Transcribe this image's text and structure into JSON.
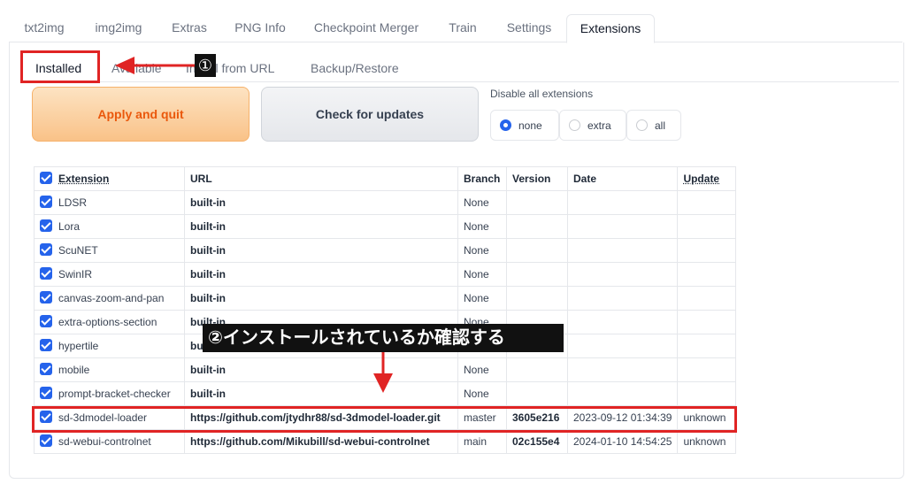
{
  "top_tabs": [
    "txt2img",
    "img2img",
    "Extras",
    "PNG Info",
    "Checkpoint Merger",
    "Train",
    "Settings",
    "Extensions"
  ],
  "sub_tabs": [
    "Installed",
    "Available",
    "Install from URL",
    "Backup/Restore"
  ],
  "buttons": {
    "apply": "Apply and quit",
    "check": "Check for updates"
  },
  "disable": {
    "label": "Disable all extensions",
    "options": [
      "none",
      "extra",
      "all"
    ],
    "selected": "none"
  },
  "table": {
    "headers": [
      "Extension",
      "URL",
      "Branch",
      "Version",
      "Date",
      "Update"
    ],
    "rows": [
      {
        "name": "LDSR",
        "url": "built-in",
        "branch": "None",
        "version": "",
        "date": "",
        "update": ""
      },
      {
        "name": "Lora",
        "url": "built-in",
        "branch": "None",
        "version": "",
        "date": "",
        "update": ""
      },
      {
        "name": "ScuNET",
        "url": "built-in",
        "branch": "None",
        "version": "",
        "date": "",
        "update": ""
      },
      {
        "name": "SwinIR",
        "url": "built-in",
        "branch": "None",
        "version": "",
        "date": "",
        "update": ""
      },
      {
        "name": "canvas-zoom-and-pan",
        "url": "built-in",
        "branch": "None",
        "version": "",
        "date": "",
        "update": ""
      },
      {
        "name": "extra-options-section",
        "url": "built-in",
        "branch": "None",
        "version": "",
        "date": "",
        "update": ""
      },
      {
        "name": "hypertile",
        "url": "built-in",
        "branch": "None",
        "version": "",
        "date": "",
        "update": ""
      },
      {
        "name": "mobile",
        "url": "built-in",
        "branch": "None",
        "version": "",
        "date": "",
        "update": ""
      },
      {
        "name": "prompt-bracket-checker",
        "url": "built-in",
        "branch": "None",
        "version": "",
        "date": "",
        "update": ""
      },
      {
        "name": "sd-3dmodel-loader",
        "url": "https://github.com/jtydhr88/sd-3dmodel-loader.git",
        "branch": "master",
        "version": "3605e216",
        "date": "2023-09-12 01:34:39",
        "update": "unknown"
      },
      {
        "name": "sd-webui-controlnet",
        "url": "https://github.com/Mikubill/sd-webui-controlnet",
        "branch": "main",
        "version": "02c155e4",
        "date": "2024-01-10 14:54:25",
        "update": "unknown"
      }
    ]
  },
  "annotations": {
    "step1": "①",
    "step2": "②インストールされているか確認する"
  },
  "colors": {
    "accent": "#2563eb",
    "annotation": "#e02424",
    "apply_text": "#ea580c"
  }
}
